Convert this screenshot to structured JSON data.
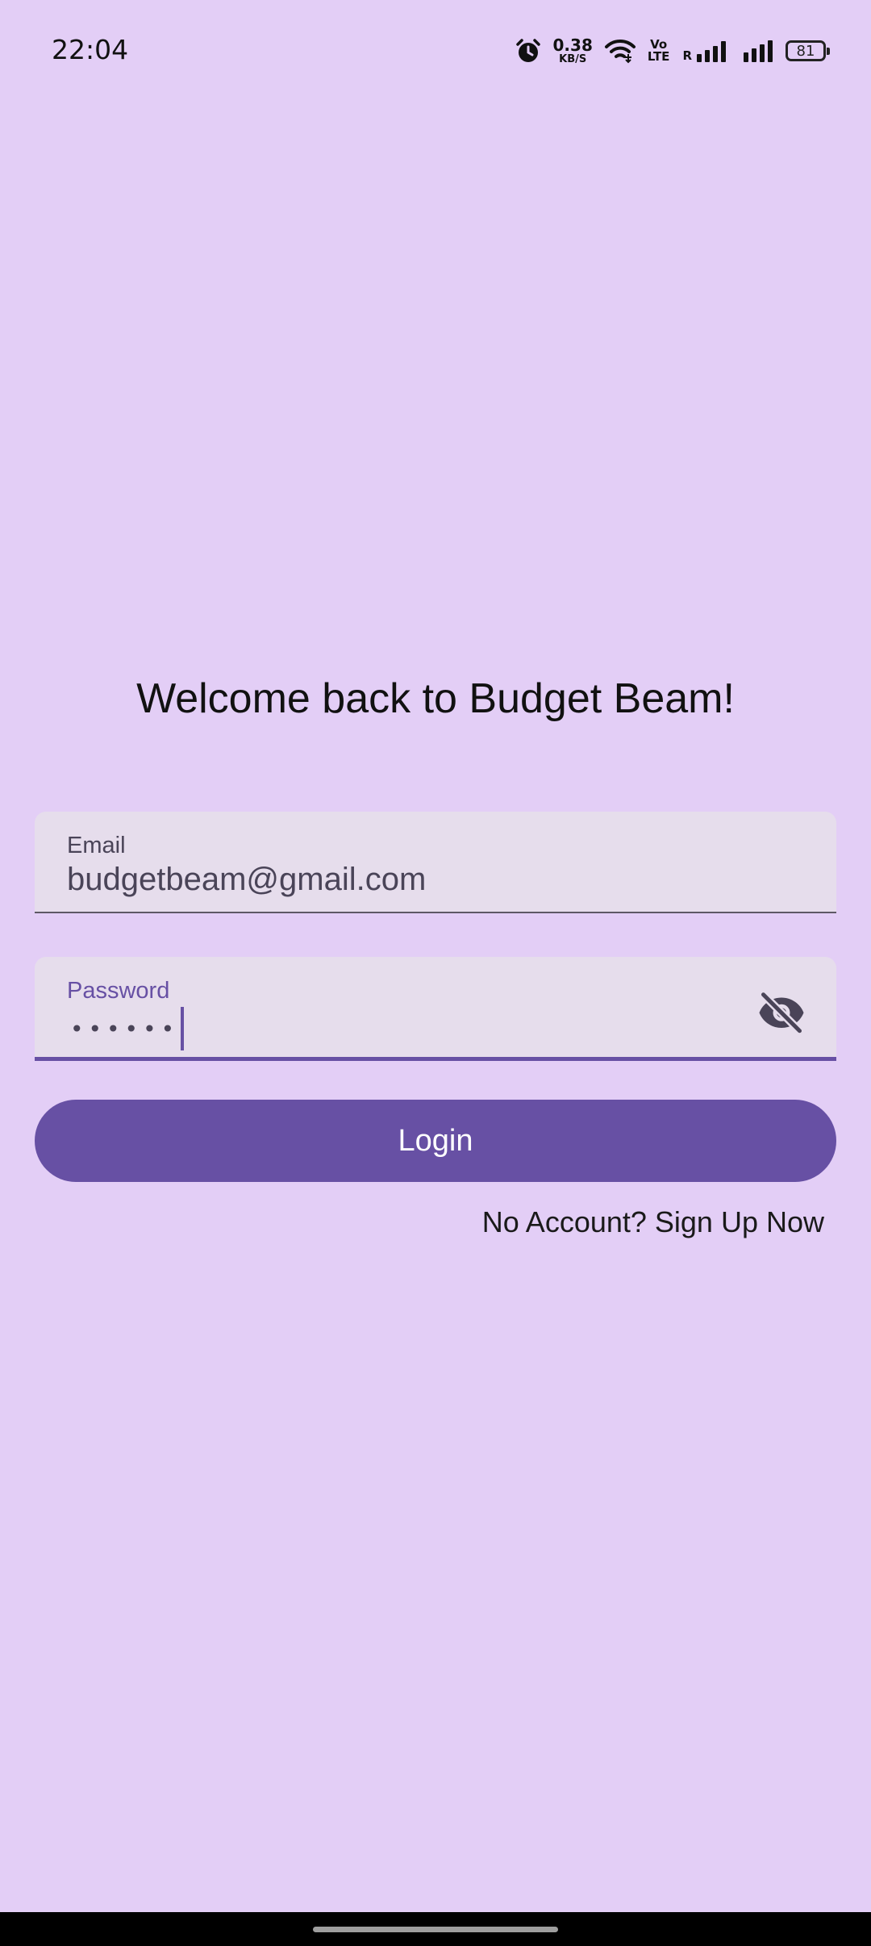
{
  "status_bar": {
    "time": "22:04",
    "net_speed_value": "0.38",
    "net_speed_unit": "KB/S",
    "volte_line1": "Vo",
    "volte_line2": "LTE",
    "roaming": "R",
    "battery": "81"
  },
  "login": {
    "title": "Welcome back to Budget Beam!",
    "email_label": "Email",
    "email_value": "budgetbeam@gmail.com",
    "password_label": "Password",
    "password_masked": "••••••",
    "login_button": "Login",
    "signup_link": "No Account? Sign Up Now"
  },
  "icons": {
    "alarm": "alarm-icon",
    "wifi": "wifi-icon",
    "signal": "signal-icon",
    "visibility_toggle": "visibility-off-icon"
  },
  "colors": {
    "background": "#E3CEF6",
    "accent": "#6750A4",
    "field_background": "#E6DDEC"
  }
}
